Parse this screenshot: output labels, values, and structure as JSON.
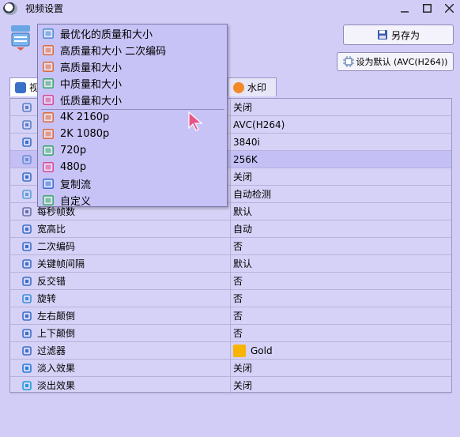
{
  "window": {
    "title": "视频设置"
  },
  "buttons": {
    "save_as": "另存为",
    "set_default": "设为默认 (AVC(H264))"
  },
  "tabs": [
    {
      "label": "视"
    },
    {
      "label": "水印"
    }
  ],
  "dropdown": {
    "items": [
      {
        "label": "最优化的质量和大小",
        "color": "#4a90d9"
      },
      {
        "label": "高质量和大小 二次编码",
        "color": "#e06b3a"
      },
      {
        "label": "高质量和大小",
        "color": "#e06b3a"
      },
      {
        "label": "中质量和大小",
        "color": "#3aa86b"
      },
      {
        "label": "低质量和大小",
        "color": "#d94a9a"
      },
      {
        "label": "4K 2160p",
        "color": "#e06b3a"
      },
      {
        "label": "2K 1080p",
        "color": "#e06b3a"
      },
      {
        "label": "720p",
        "color": "#3aa86b"
      },
      {
        "label": "480p",
        "color": "#d94a9a"
      },
      {
        "label": "复制流",
        "color": "#3a6fd9"
      },
      {
        "label": "自定义",
        "color": "#3aa86b"
      }
    ]
  },
  "properties": [
    {
      "name": "",
      "value": "关闭",
      "icon": "codec-icon"
    },
    {
      "name": "",
      "value": "AVC(H264)",
      "icon": "chip-icon"
    },
    {
      "name": "",
      "value": "3840i",
      "icon": "monitor-icon"
    },
    {
      "name": "",
      "value": "256K",
      "icon": "wave-icon",
      "selected": true
    },
    {
      "name": "",
      "value": "关闭",
      "icon": "atom-icon"
    },
    {
      "name": "",
      "value": "自动检测",
      "icon": "image-icon"
    },
    {
      "name": "每秒帧数",
      "value": "默认",
      "icon": "fps-icon"
    },
    {
      "name": "宽高比",
      "value": "自动",
      "icon": "aspect-icon"
    },
    {
      "name": "二次编码",
      "value": "否",
      "icon": "two-pass-icon"
    },
    {
      "name": "关键帧间隔",
      "value": "默认",
      "icon": "keyframe-icon"
    },
    {
      "name": "反交错",
      "value": "否",
      "icon": "deinterlace-icon"
    },
    {
      "name": "旋转",
      "value": "否",
      "icon": "rotate-icon"
    },
    {
      "name": "左右颠倒",
      "value": "否",
      "icon": "flip-horizontal-icon"
    },
    {
      "name": "上下颠倒",
      "value": "否",
      "icon": "flip-vertical-icon"
    },
    {
      "name": "过滤器",
      "value": "Gold",
      "icon": "filter-icon",
      "swatch": "#f6b400"
    },
    {
      "name": "淡入效果",
      "value": "关闭",
      "icon": "fade-in-icon"
    },
    {
      "name": "淡出效果",
      "value": "关闭",
      "icon": "fade-out-icon"
    }
  ]
}
